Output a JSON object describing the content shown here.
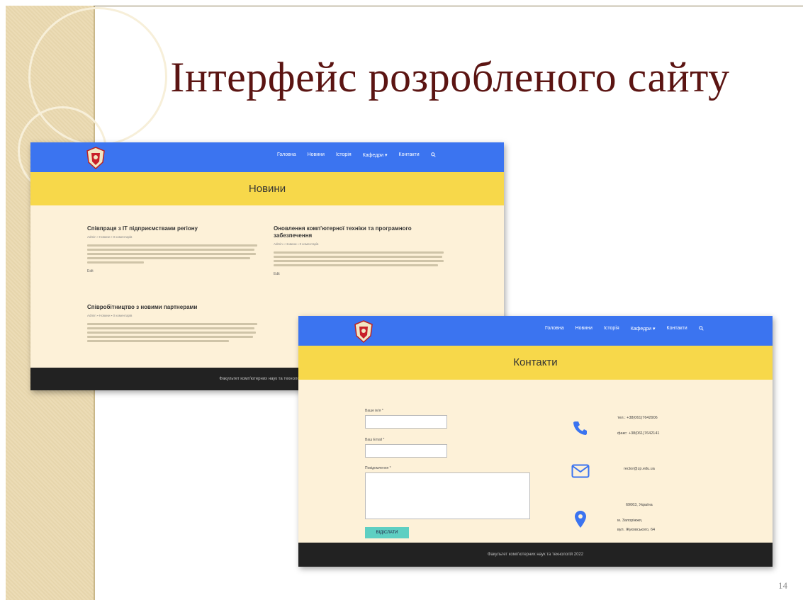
{
  "slide": {
    "title": "Інтерфейс розробленого сайту",
    "page_number": "14"
  },
  "news_page": {
    "nav": [
      "Головна",
      "Новини",
      "Історія",
      "Кафедри ▾",
      "Контакти"
    ],
    "banner_title": "Новини",
    "posts": [
      {
        "title": "Співпраця з IT підприємствами регіону",
        "meta": "Admin ▪ Новини ▪ 0 коментарів",
        "edit": "Edit"
      },
      {
        "title": "Оновлення комп'ютерної техніки та програмного забезпечення",
        "meta": "Admin ▪ Новини ▪ 0 коментарів",
        "edit": "Edit"
      },
      {
        "title": "Співробітництво з новими партнерами",
        "meta": "Admin ▪ Новини ▪ 0 коментарів",
        "edit": ""
      }
    ],
    "footer": "Факультет комп'ютерних наук та технологій 2022"
  },
  "contacts_page": {
    "nav": [
      "Головна",
      "Новини",
      "Історія",
      "Кафедри ▾",
      "Контакти"
    ],
    "banner_title": "Контакти",
    "form": {
      "name_label": "Ваше ім'я *",
      "email_label": "Ваш Email *",
      "message_label": "Повідомлення *",
      "submit_label": "ВІДІСЛАТИ"
    },
    "contacts": {
      "phone": "тел.: +38(061)7642906",
      "fax": "факс: +38(061)7642141",
      "email": "rector@zp.edu.ua",
      "address_line1": "69063, Україна",
      "address_line2": "м. Запоріжжя,",
      "address_line3": "вул. Жуковського, 64"
    },
    "footer": "Факультет комп'ютерних наук та технологій 2022"
  },
  "colors": {
    "nav": "#3b74f0",
    "banner": "#f7d84a",
    "body": "#fdf1d8",
    "footer": "#222222",
    "title": "#5b1412",
    "icons": "#3b74f0"
  }
}
